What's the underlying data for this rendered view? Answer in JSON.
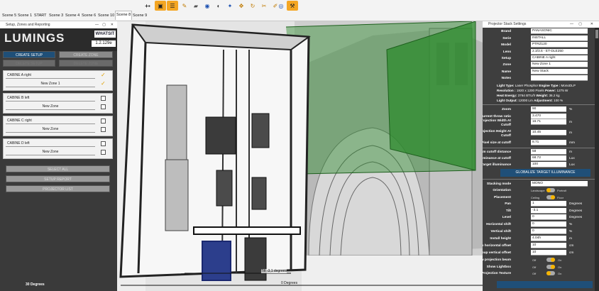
{
  "scene_tabs": [
    "Scene 5",
    "Scene 1",
    "START",
    "Scene 3",
    "Scene 4",
    "Scene 6",
    "Scene 10",
    "Scene 8",
    "Scene 9"
  ],
  "toolbar_icons": [
    "add-projector-icon",
    "camera-list-icon",
    "list-icon",
    "wrench-icon",
    "projector-icon",
    "globe-icon",
    "eye-icon",
    "snap-icon",
    "move-icon",
    "rotate-icon",
    "cut-icon",
    "paint-icon",
    "visibility-icon",
    "settings-wrench-icon"
  ],
  "left_panel": {
    "title": "Setup, Zones and Reporting",
    "logo": "LUMINGS",
    "whats_it": "WHATSIT",
    "version": "1.2.129e",
    "create_setup": "CREATE SETUP",
    "create_zone": "CREATE ZONE",
    "delete_setup": "DELETE SETUP",
    "delete_zone": "DELETE ZONE",
    "cabins": [
      {
        "name": "CABINE A right",
        "zone": "New Zone 1",
        "checked": true
      },
      {
        "name": "CABINE B left",
        "zone": "New Zone",
        "checked": false
      },
      {
        "name": "CABINE C right",
        "zone": "New Zone",
        "checked": false
      },
      {
        "name": "CABINE D left",
        "zone": "New Zone",
        "checked": false
      }
    ],
    "select_all": "SELECT ALL",
    "setup_report": "SETUP REPORT",
    "projector_list": "PROJECTOR LIST",
    "status_degrees": "30 Degrees"
  },
  "viewport": {
    "label_tilt": "Tilt -3,1 degrees",
    "label_zero": "0 Degrees"
  },
  "right_panel": {
    "title": "Projector Stack Settings",
    "fields": {
      "brand": {
        "label": "Brand",
        "value": "PANASONIC"
      },
      "serie": {
        "label": "Serie",
        "value": "INSTALL"
      },
      "model": {
        "label": "Model",
        "value": "PTRZ120"
      },
      "lens": {
        "label": "Lens",
        "value": "2.3/3.6 - ET-DLE250"
      },
      "setup": {
        "label": "Setup",
        "value": "CABINE A right"
      },
      "zone": {
        "label": "Zone",
        "value": "New Zone 1"
      },
      "name": {
        "label": "Name",
        "value": "New Stack"
      },
      "notes": {
        "label": "Notes",
        "value": ""
      }
    },
    "info_lines": [
      {
        "k1": "Light Type:",
        "v1": "Laser Phosphor",
        "k2": "Engine Type :",
        "v2": "MonoDLP"
      },
      {
        "k1": "Resolution :",
        "v1": "1920 x 1200 Pixels",
        "k2": "Power:",
        "v2": "1275 W"
      },
      {
        "k1": "Heat Energy:",
        "v1": "3764 BTU/h",
        "k2": "Weight:",
        "v2": "36.2 kg"
      },
      {
        "k1": "Light Output:",
        "v1": "12000 Lm",
        "k2": "Adjustment:",
        "v2": "100 %"
      }
    ],
    "calc": [
      {
        "label": "Zoom",
        "value": "90",
        "unit": "%"
      },
      {
        "label": "Current throw ratio",
        "value": "3.470",
        "unit": ""
      },
      {
        "label": "Projection Width At Cutoff",
        "value": "16.71",
        "unit": "m"
      },
      {
        "label": "Projection Height At Cutoff",
        "value": "10.45",
        "unit": "m"
      },
      {
        "label": "Pixel size at cutoff",
        "value": "8.71",
        "unit": "mm"
      },
      {
        "label": "Beam cutoff distance",
        "value": "58",
        "unit": "m"
      },
      {
        "label": "Illuminance at cutoff",
        "value": "68.72",
        "unit": "Lux"
      },
      {
        "label": "Target illuminance",
        "value": "100",
        "unit": "Lux"
      }
    ],
    "globalize": "GLOBALIZE TARGET ILLUMINANCE",
    "stacking_mode": {
      "label": "Stacking mode",
      "value": "MONO"
    },
    "orientation": {
      "label": "Orientation",
      "off": "Landscape",
      "on": "Portrait",
      "state": "off"
    },
    "placement": {
      "label": "Placement",
      "off": "Ceiling",
      "on": "Floor",
      "state": "on"
    },
    "geometry": [
      {
        "label": "Pan",
        "value": "1",
        "unit": "Degrees"
      },
      {
        "label": "Tilt",
        "value": "-3.1",
        "unit": "Degrees"
      },
      {
        "label": "Level",
        "value": "0",
        "unit": "Degrees"
      },
      {
        "label": "Horizontal shift",
        "value": "0",
        "unit": "%"
      },
      {
        "label": "Vertical shift",
        "value": "0",
        "unit": "%"
      },
      {
        "label": "Install height",
        "value": "4.04h",
        "unit": "m"
      },
      {
        "label": "Group horizontal offset",
        "value": "10",
        "unit": "cm"
      },
      {
        "label": "Group vertical offset",
        "value": "10",
        "unit": "cm"
      }
    ],
    "toggles": [
      {
        "label": "Show projection beam",
        "off": "Off",
        "on": "On",
        "state": "on"
      },
      {
        "label": "Show Lightbox",
        "off": "Off",
        "on": "On",
        "state": "on"
      },
      {
        "label": "Projection Texture",
        "off": "Off",
        "on": "On",
        "state": "off"
      }
    ]
  },
  "colors": {
    "accent_blue": "#1f4f78",
    "beam_green": "#2e8b2e",
    "toggle_yellow": "#f5b400",
    "check_orange": "#e0a000"
  }
}
